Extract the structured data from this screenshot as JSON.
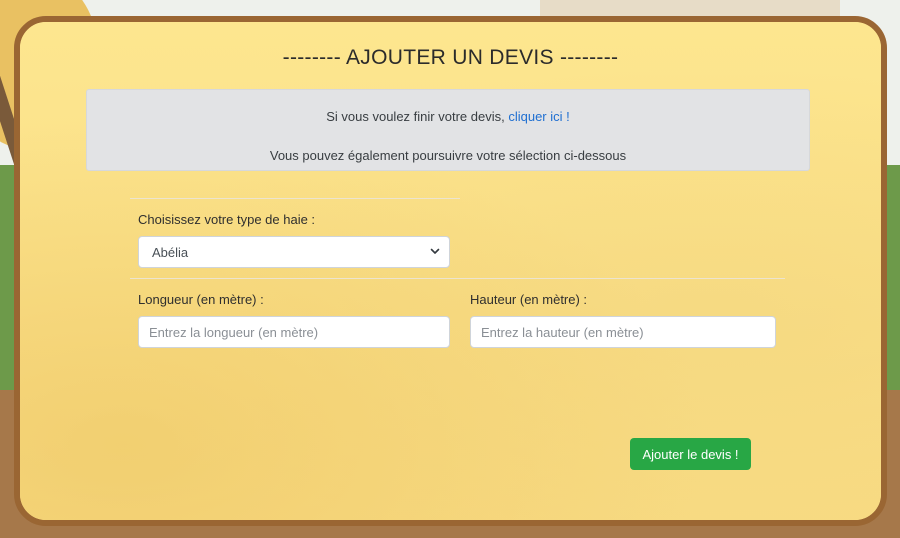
{
  "header": {
    "title": "-------- AJOUTER UN DEVIS --------"
  },
  "notice": {
    "line1_text": "Si vous voulez finir votre devis,",
    "line1_link": "cliquer ici !",
    "line2_text": "Vous pouvez également poursuivre votre sélection ci-dessous"
  },
  "form": {
    "hedge_type": {
      "label": "Choisissez votre type de haie :",
      "selected": "Abélia"
    },
    "length": {
      "label": "Longueur (en mètre) :",
      "placeholder": "Entrez la longueur (en mètre)"
    },
    "height": {
      "label": "Hauteur (en mètre) :",
      "placeholder": "Entrez la hauteur (en mètre)"
    },
    "submit_label": "Ajouter le devis !"
  },
  "colors": {
    "card_bg": "#fbe38c",
    "card_border": "#9a6633",
    "notice_bg": "#e2e3e5",
    "link": "#1f6fd1",
    "submit_bg": "#28a745"
  },
  "icons": {
    "select_arrow": "chevron-down-icon"
  }
}
